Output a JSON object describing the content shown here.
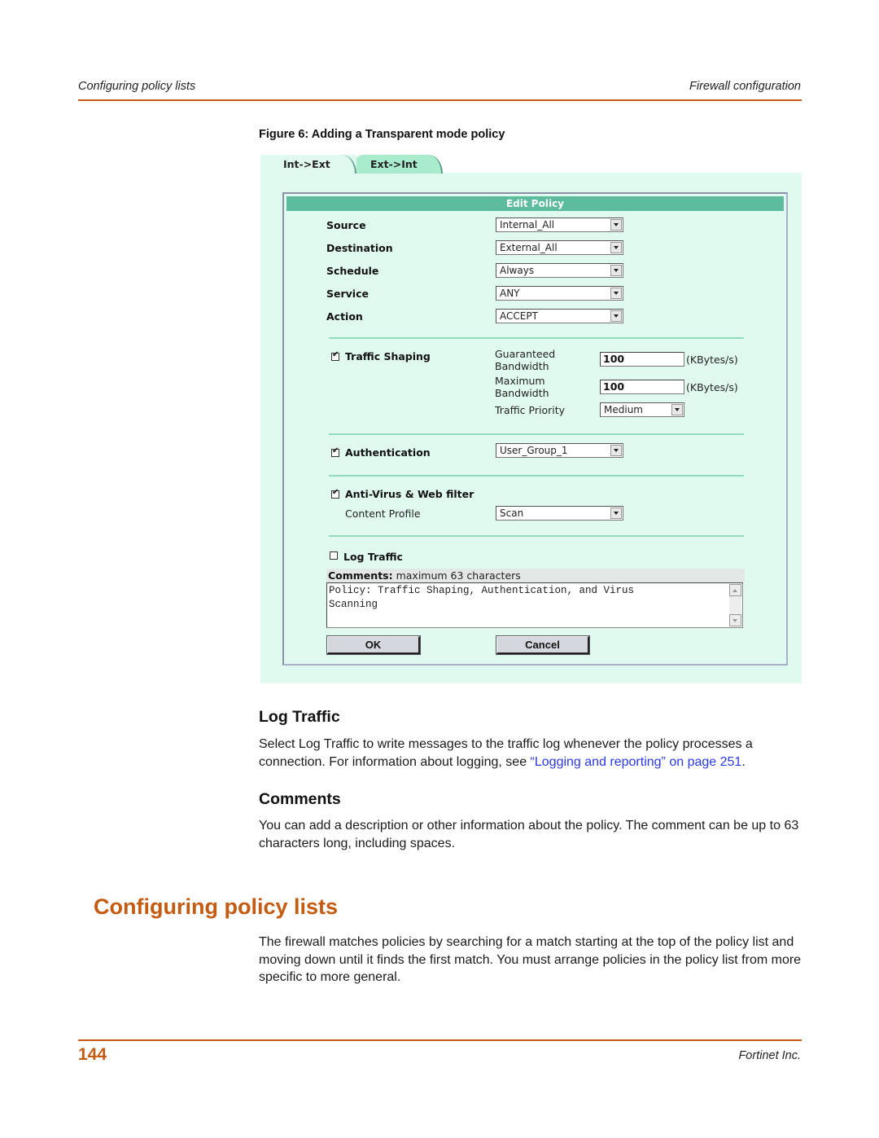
{
  "header": {
    "section": "Configuring policy lists",
    "chapter": "Firewall configuration"
  },
  "figure": {
    "caption": "Figure 6:  Adding a Transparent mode policy",
    "tabs": [
      {
        "label": "Int->Ext",
        "active": true
      },
      {
        "label": "Ext->Int",
        "active": false
      }
    ],
    "panel_title": "Edit Policy",
    "fields": [
      {
        "label": "Source",
        "value": "Internal_All"
      },
      {
        "label": "Destination",
        "value": "External_All"
      },
      {
        "label": "Schedule",
        "value": "Always"
      },
      {
        "label": "Service",
        "value": "ANY"
      },
      {
        "label": "Action",
        "value": "ACCEPT"
      }
    ],
    "traffic_shaping": {
      "label": "Traffic Shaping",
      "checked": true,
      "guaranteed_label_1": "Guaranteed",
      "guaranteed_label_2": "Bandwidth",
      "guaranteed_value": "100",
      "maximum_label_1": "Maximum",
      "maximum_label_2": "Bandwidth",
      "maximum_value": "100",
      "unit": "(KBytes/s)",
      "priority_label": "Traffic Priority",
      "priority_value": "Medium"
    },
    "authentication": {
      "label": "Authentication",
      "checked": true,
      "value": "User_Group_1"
    },
    "antivirus": {
      "label": "Anti-Virus & Web filter",
      "checked": true,
      "profile_label": "Content Profile",
      "profile_value": "Scan"
    },
    "log_traffic": {
      "label": "Log Traffic",
      "checked": false
    },
    "comments": {
      "label": "Comments:",
      "hint": " maximum 63 characters",
      "value": "Policy: Traffic Shaping, Authentication, and Virus\nScanning"
    },
    "buttons": {
      "ok": "OK",
      "cancel": "Cancel"
    }
  },
  "sections": {
    "log_traffic_heading": "Log Traffic",
    "log_traffic_text": "Select Log Traffic to write messages to the traffic log whenever the policy processes a connection. For information about logging, see ",
    "log_traffic_link": "“Logging and reporting” on page 251",
    "log_traffic_end": ".",
    "comments_heading": "Comments",
    "comments_text": "You can add a description or other information about the policy. The comment can be up to 63 characters long, including spaces.",
    "policy_lists_heading": "Configuring policy lists",
    "policy_lists_text": "The firewall matches policies by searching for a match starting at the top of the policy list and moving down until it finds the first match. You must arrange policies in the policy list from more specific to more general."
  },
  "footer": {
    "page_number": "144",
    "company": "Fortinet Inc."
  },
  "colors": {
    "accent": "#c55a11",
    "link": "#2a39e6",
    "panel_bg": "#e1faf0",
    "panel_title_bg": "#5ebc9e"
  }
}
